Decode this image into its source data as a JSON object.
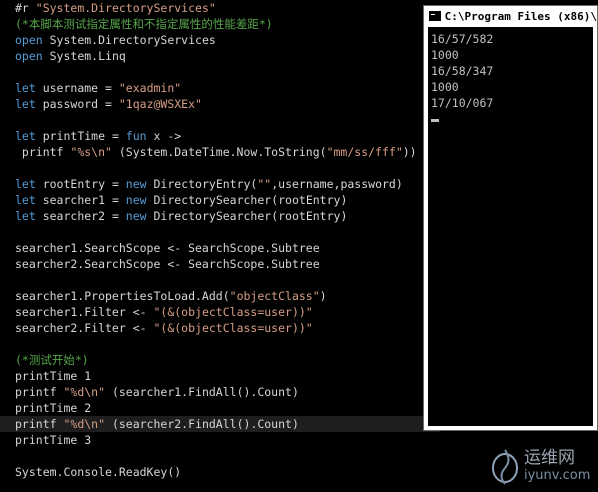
{
  "editor": {
    "lines": [
      {
        "parts": [
          {
            "c": "op",
            "t": "#r "
          },
          {
            "c": "str",
            "t": "\"System.DirectoryServices\""
          }
        ]
      },
      {
        "parts": [
          {
            "c": "cm",
            "t": "(*本脚本测试指定属性和不指定属性的性能差距*)"
          }
        ]
      },
      {
        "parts": [
          {
            "c": "kw",
            "t": "open"
          },
          {
            "c": "op",
            "t": " System.DirectoryServices"
          }
        ]
      },
      {
        "parts": [
          {
            "c": "kw",
            "t": "open"
          },
          {
            "c": "op",
            "t": " System.Linq"
          }
        ]
      },
      {
        "parts": []
      },
      {
        "parts": [
          {
            "c": "kw",
            "t": "let"
          },
          {
            "c": "op",
            "t": " username = "
          },
          {
            "c": "str",
            "t": "\"exadmin\""
          }
        ]
      },
      {
        "parts": [
          {
            "c": "kw",
            "t": "let"
          },
          {
            "c": "op",
            "t": " password = "
          },
          {
            "c": "str",
            "t": "\"1qaz@WSXEx\""
          }
        ]
      },
      {
        "parts": []
      },
      {
        "parts": [
          {
            "c": "kw",
            "t": "let"
          },
          {
            "c": "op",
            "t": " printTime = "
          },
          {
            "c": "kw",
            "t": "fun"
          },
          {
            "c": "op",
            "t": " x -> "
          }
        ]
      },
      {
        "parts": [
          {
            "c": "op",
            "t": " printf "
          },
          {
            "c": "str",
            "t": "\"%s\\n\""
          },
          {
            "c": "op",
            "t": " (System.DateTime.Now.ToString("
          },
          {
            "c": "str",
            "t": "\"mm/ss/fff\""
          },
          {
            "c": "op",
            "t": "))"
          }
        ]
      },
      {
        "parts": []
      },
      {
        "parts": [
          {
            "c": "kw",
            "t": "let"
          },
          {
            "c": "op",
            "t": " rootEntry = "
          },
          {
            "c": "kw",
            "t": "new"
          },
          {
            "c": "op",
            "t": " DirectoryEntry("
          },
          {
            "c": "str",
            "t": "\"\""
          },
          {
            "c": "op",
            "t": ",username,password)"
          }
        ]
      },
      {
        "parts": [
          {
            "c": "kw",
            "t": "let"
          },
          {
            "c": "op",
            "t": " searcher1 = "
          },
          {
            "c": "kw",
            "t": "new"
          },
          {
            "c": "op",
            "t": " DirectorySearcher(rootEntry)"
          }
        ]
      },
      {
        "parts": [
          {
            "c": "kw",
            "t": "let"
          },
          {
            "c": "op",
            "t": " searcher2 = "
          },
          {
            "c": "kw",
            "t": "new"
          },
          {
            "c": "op",
            "t": " DirectorySearcher(rootEntry)"
          }
        ]
      },
      {
        "parts": []
      },
      {
        "parts": [
          {
            "c": "op",
            "t": "searcher1.SearchScope <- SearchScope.Subtree"
          }
        ]
      },
      {
        "parts": [
          {
            "c": "op",
            "t": "searcher2.SearchScope <- SearchScope.Subtree"
          }
        ]
      },
      {
        "parts": []
      },
      {
        "parts": [
          {
            "c": "op",
            "t": "searcher1.PropertiesToLoad.Add("
          },
          {
            "c": "str",
            "t": "\"objectClass\""
          },
          {
            "c": "op",
            "t": ")"
          }
        ]
      },
      {
        "parts": [
          {
            "c": "op",
            "t": "searcher1.Filter <- "
          },
          {
            "c": "str",
            "t": "\"(&(objectClass=user))\""
          }
        ]
      },
      {
        "parts": [
          {
            "c": "op",
            "t": "searcher2.Filter <- "
          },
          {
            "c": "str",
            "t": "\"(&(objectClass=user))\""
          }
        ]
      },
      {
        "parts": []
      },
      {
        "parts": [
          {
            "c": "cm",
            "t": "(*测试开始*)"
          }
        ]
      },
      {
        "parts": [
          {
            "c": "op",
            "t": "printTime 1"
          }
        ]
      },
      {
        "parts": [
          {
            "c": "op",
            "t": "printf "
          },
          {
            "c": "str",
            "t": "\"%d\\n\""
          },
          {
            "c": "op",
            "t": " (searcher1.FindAll().Count)"
          }
        ]
      },
      {
        "parts": [
          {
            "c": "op",
            "t": "printTime 2"
          }
        ]
      },
      {
        "parts": [
          {
            "c": "op",
            "t": "printf "
          },
          {
            "c": "str",
            "t": "\"%d\\n\""
          },
          {
            "c": "op",
            "t": " (searcher2.FindAll().Count)"
          }
        ],
        "highlight": true
      },
      {
        "parts": [
          {
            "c": "op",
            "t": "printTime 3"
          }
        ]
      },
      {
        "parts": []
      },
      {
        "parts": [
          {
            "c": "op",
            "t": "System.Console.ReadKey()"
          }
        ]
      }
    ]
  },
  "console": {
    "title": "C:\\Program Files (x86)\\",
    "icon": "console-window-icon",
    "output": [
      "16/57/582",
      "1000",
      "16/58/347",
      "1000",
      "17/10/067"
    ]
  },
  "watermark": {
    "cn": "运维网",
    "url": "iyunv.com"
  }
}
